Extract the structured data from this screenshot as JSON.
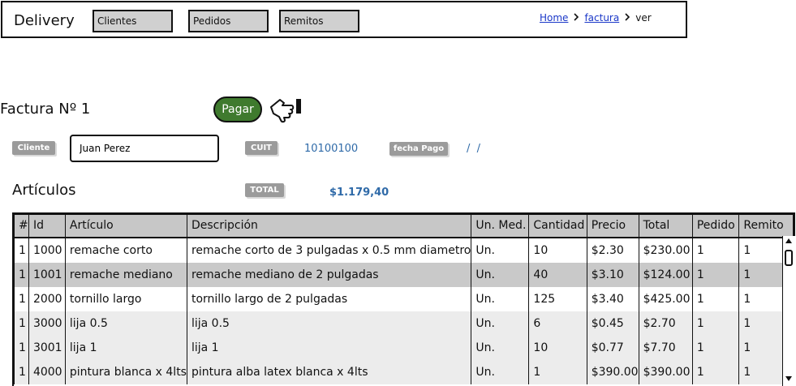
{
  "app": {
    "title": "Delivery"
  },
  "nav": [
    {
      "label": "Clientes"
    },
    {
      "label": "Pedidos"
    },
    {
      "label": "Remitos"
    }
  ],
  "breadcrumb": {
    "home": "Home",
    "factura": "factura",
    "current": "ver"
  },
  "invoice": {
    "title": "Factura Nº 1",
    "pay_label": "Pagar",
    "cliente_label": "Cliente",
    "cliente_value": "Juan Perez",
    "cuit_label": "CUIT",
    "cuit_value": "10100100",
    "fecha_label": "fecha Pago",
    "fecha_value": "/  /",
    "section_title": "Artículos",
    "total_label": "TOTAL",
    "total_value": "$1.179,40"
  },
  "table": {
    "columns": [
      "#",
      "Id",
      "Artículo",
      "Descripción",
      "Un. Med.",
      "Cantidad",
      "Precio",
      "Total",
      "Pedido",
      "Remito"
    ],
    "rows": [
      [
        "1",
        "1000",
        "remache corto",
        "remache corto de 3 pulgadas x 0.5 mm diametro",
        "Un.",
        "10",
        "$2.30",
        "$230.00",
        "1",
        "1"
      ],
      [
        "1",
        "1001",
        "remache mediano",
        "remache mediano de 2 pulgadas",
        "Un.",
        "40",
        "$3.10",
        "$124.00",
        "1",
        "1"
      ],
      [
        "1",
        "2000",
        "tornillo largo",
        "tornillo largo de 2 pulgadas",
        "Un.",
        "125",
        "$3.40",
        "$425.00",
        "1",
        "1"
      ],
      [
        "1",
        "3000",
        "lija 0.5",
        "lija 0.5",
        "Un.",
        "6",
        "$0.45",
        "$2.70",
        "1",
        "1"
      ],
      [
        "1",
        "3001",
        "lija 1",
        "lija 1",
        "Un.",
        "10",
        "$0.77",
        "$7.70",
        "1",
        "1"
      ],
      [
        "1",
        "4000",
        "pintura blanca x 4lts",
        "pintura alba latex blanca x 4lts",
        "Un.",
        "1",
        "$390.00",
        "$390.00",
        "1",
        "1"
      ]
    ],
    "selected_row": 1
  },
  "icons": {
    "pay_hint": "thumb-pointing-icon",
    "breadcrumb_separator": "chevron-right-icon"
  },
  "colors": {
    "pay_button": "#3f7a2e",
    "link": "#1a37c8",
    "value_text": "#2f6aa8",
    "tag_bg": "#9b9b9b",
    "header_bg": "#c7c7c7"
  }
}
